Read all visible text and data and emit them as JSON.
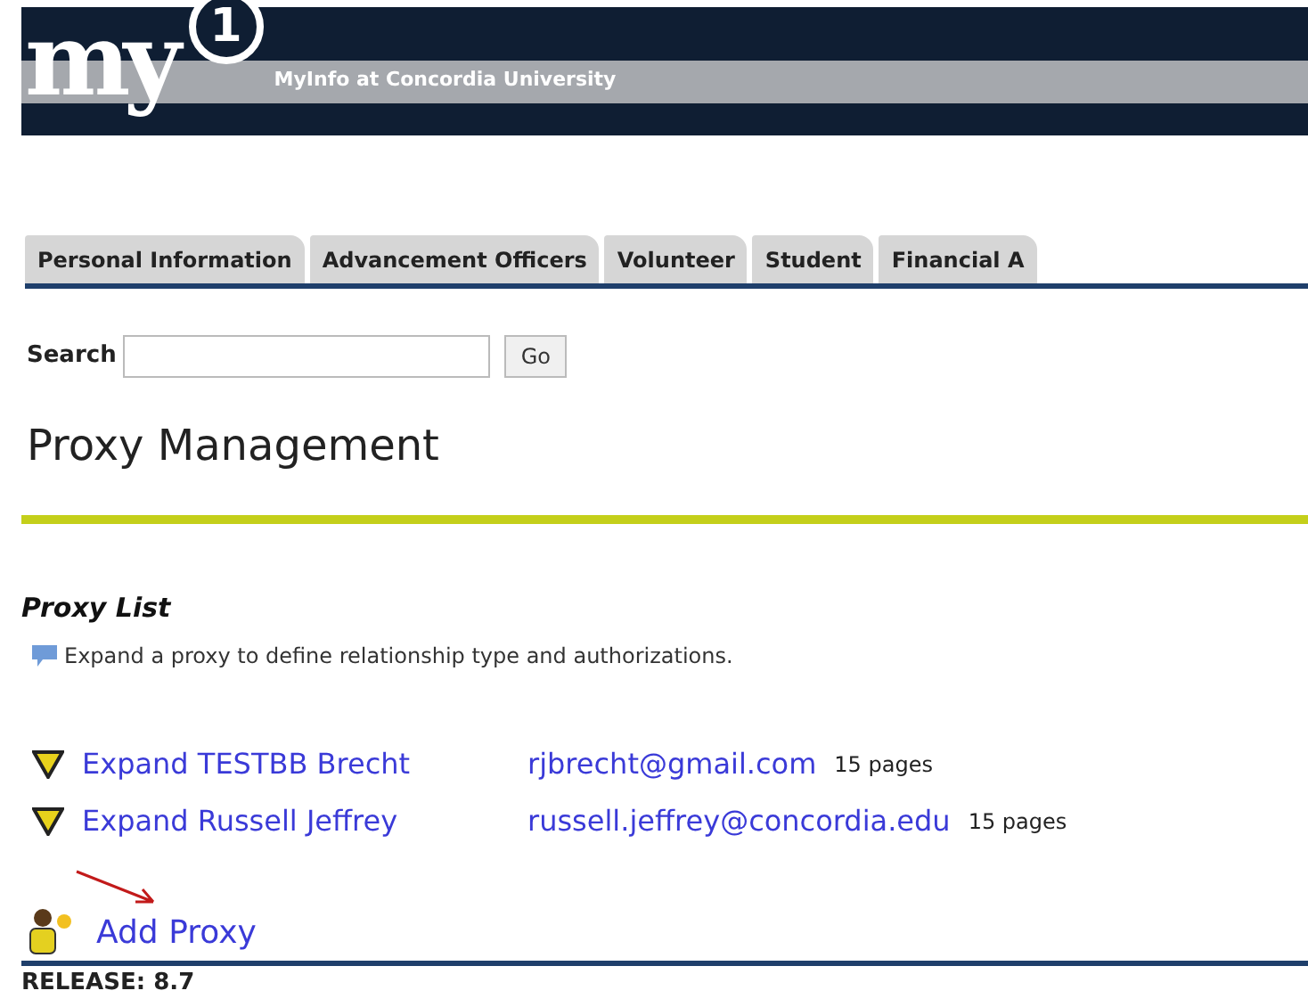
{
  "banner": {
    "logo_letters": "my",
    "logo_badge": "1",
    "title": "MyInfo at Concordia University"
  },
  "tabs": [
    {
      "label": "Personal Information"
    },
    {
      "label": "Advancement Officers"
    },
    {
      "label": "Volunteer"
    },
    {
      "label": "Student"
    },
    {
      "label": "Financial A"
    }
  ],
  "search": {
    "label": "Search",
    "button": "Go"
  },
  "page_title": "Proxy Management",
  "proxy_list": {
    "heading": "Proxy List",
    "note": "Expand a proxy to define relationship type and authorizations.",
    "proxies": [
      {
        "link": "Expand TESTBB Brecht",
        "email": "rjbrecht@gmail.com",
        "pages": "15 pages"
      },
      {
        "link": "Expand Russell Jeffrey",
        "email": "russell.jeffrey@concordia.edu",
        "pages": "15 pages"
      }
    ]
  },
  "add_proxy": "Add Proxy",
  "release": "RELEASE: 8.7"
}
